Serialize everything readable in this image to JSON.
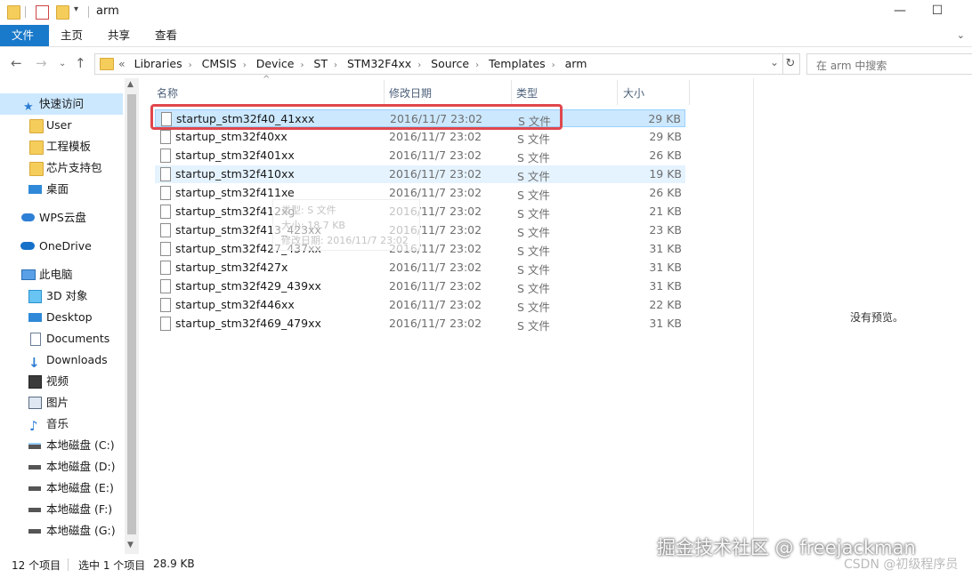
{
  "window": {
    "title": "arm",
    "minimize": "—",
    "maximize": "☐"
  },
  "ribbon": {
    "tabs": [
      "文件",
      "主页",
      "共享",
      "查看"
    ]
  },
  "address": {
    "overflow": "«",
    "crumbs": [
      "Libraries",
      "CMSIS",
      "Device",
      "ST",
      "STM32F4xx",
      "Source",
      "Templates",
      "arm"
    ],
    "search_placeholder": "在 arm 中搜索"
  },
  "sidebar": {
    "items": [
      {
        "label": "快速访问",
        "icon": "star-icon"
      },
      {
        "label": "User",
        "icon": "folder-icon"
      },
      {
        "label": "工程模板",
        "icon": "folder-icon"
      },
      {
        "label": "芯片支持包",
        "icon": "folder-icon"
      },
      {
        "label": "桌面",
        "icon": "desktop-icon"
      },
      {
        "label": "WPS云盘",
        "icon": "cloud-icon"
      },
      {
        "label": "OneDrive",
        "icon": "onedrive-icon"
      },
      {
        "label": "此电脑",
        "icon": "computer-icon"
      },
      {
        "label": "3D 对象",
        "icon": "cube-icon"
      },
      {
        "label": "Desktop",
        "icon": "desktop-icon"
      },
      {
        "label": "Documents",
        "icon": "document-icon"
      },
      {
        "label": "Downloads",
        "icon": "download-icon"
      },
      {
        "label": "视频",
        "icon": "video-icon"
      },
      {
        "label": "图片",
        "icon": "picture-icon"
      },
      {
        "label": "音乐",
        "icon": "music-icon"
      },
      {
        "label": "本地磁盘 (C:)",
        "icon": "drive-icon"
      },
      {
        "label": "本地磁盘 (D:)",
        "icon": "drive-icon"
      },
      {
        "label": "本地磁盘 (E:)",
        "icon": "drive-icon"
      },
      {
        "label": "本地磁盘 (F:)",
        "icon": "drive-icon"
      },
      {
        "label": "本地磁盘 (G:)",
        "icon": "drive-icon"
      }
    ]
  },
  "columns": {
    "name": "名称",
    "date": "修改日期",
    "type": "类型",
    "size": "大小"
  },
  "files": [
    {
      "name": "startup_stm32f40_41xxx",
      "date": "2016/11/7 23:02",
      "type": "S 文件",
      "size": "29 KB"
    },
    {
      "name": "startup_stm32f40xx",
      "date": "2016/11/7 23:02",
      "type": "S 文件",
      "size": "29 KB"
    },
    {
      "name": "startup_stm32f401xx",
      "date": "2016/11/7 23:02",
      "type": "S 文件",
      "size": "26 KB"
    },
    {
      "name": "startup_stm32f410xx",
      "date": "2016/11/7 23:02",
      "type": "S 文件",
      "size": "19 KB"
    },
    {
      "name": "startup_stm32f411xe",
      "date": "2016/11/7 23:02",
      "type": "S 文件",
      "size": "26 KB"
    },
    {
      "name": "startup_stm32f412xg",
      "date": "2016/11/7 23:02",
      "type": "S 文件",
      "size": "21 KB"
    },
    {
      "name": "startup_stm32f413_423xx",
      "date": "2016/11/7 23:02",
      "type": "S 文件",
      "size": "23 KB"
    },
    {
      "name": "startup_stm32f427_437xx",
      "date": "2016/11/7 23:02",
      "type": "S 文件",
      "size": "31 KB"
    },
    {
      "name": "startup_stm32f427x",
      "date": "2016/11/7 23:02",
      "type": "S 文件",
      "size": "31 KB"
    },
    {
      "name": "startup_stm32f429_439xx",
      "date": "2016/11/7 23:02",
      "type": "S 文件",
      "size": "31 KB"
    },
    {
      "name": "startup_stm32f446xx",
      "date": "2016/11/7 23:02",
      "type": "S 文件",
      "size": "22 KB"
    },
    {
      "name": "startup_stm32f469_479xx",
      "date": "2016/11/7 23:02",
      "type": "S 文件",
      "size": "31 KB"
    }
  ],
  "tooltip": {
    "type_line": "类型: S 文件",
    "size_line": "大小: 18.7 KB",
    "date_line": "修改日期: 2016/11/7 23:02"
  },
  "preview": {
    "message": "没有预览。"
  },
  "status": {
    "count": "12 个项目",
    "selection": "选中 1 个项目",
    "selection_size": "28.9 KB"
  },
  "watermark": {
    "main": "掘金技术社区 @ freejackman",
    "csdn": "CSDN @初级程序员"
  }
}
